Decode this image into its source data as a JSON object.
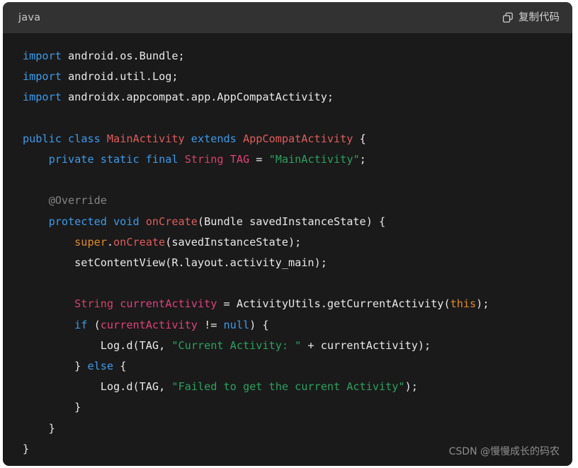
{
  "header": {
    "language_label": "java",
    "copy_label": "复制代码",
    "copy_icon": "copy-icon"
  },
  "colors": {
    "page_background": "#ffffff",
    "header_background": "#323232",
    "code_background": "#1a1a1a",
    "keyword": "#3d9ae8",
    "type_name": "#e05c5c",
    "class_type": "#d6416e",
    "variable": "#e0407a",
    "string": "#2ba05f",
    "annotation": "#848484",
    "orange_keyword": "#e08b26",
    "plain_text": "#e8e8e8",
    "watermark": "#8e8e8e"
  },
  "code": {
    "language": "java",
    "lines": [
      "import android.os.Bundle;",
      "import android.util.Log;",
      "import androidx.appcompat.app.AppCompatActivity;",
      "",
      "public class MainActivity extends AppCompatActivity {",
      "    private static final String TAG = \"MainActivity\";",
      "",
      "    @Override",
      "    protected void onCreate(Bundle savedInstanceState) {",
      "        super.onCreate(savedInstanceState);",
      "        setContentView(R.layout.activity_main);",
      "",
      "        String currentActivity = ActivityUtils.getCurrentActivity(this);",
      "        if (currentActivity != null) {",
      "            Log.d(TAG, \"Current Activity: \" + currentActivity);",
      "        } else {",
      "            Log.d(TAG, \"Failed to get the current Activity\");",
      "        }",
      "    }",
      "}"
    ]
  },
  "watermark": {
    "text": "CSDN @慢慢成长的码农"
  }
}
